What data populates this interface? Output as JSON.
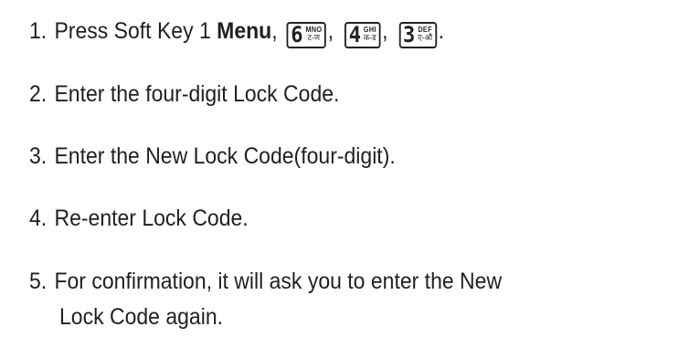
{
  "steps": [
    {
      "number": "1.",
      "text_before": "Press Soft Key 1 ",
      "bold_text": "Menu",
      "after_bold": ",",
      "keys": [
        {
          "digit": "6",
          "top": "MNO",
          "bottom": "ट-ण",
          "sep": ","
        },
        {
          "digit": "4",
          "top": "GHI",
          "bottom": "क-ड",
          "sep": ","
        },
        {
          "digit": "3",
          "top": "DEF",
          "bottom": "ए-औ",
          "sep": "."
        }
      ]
    },
    {
      "number": "2.",
      "text": "Enter the four-digit Lock Code."
    },
    {
      "number": "3.",
      "text": "Enter the New Lock Code(four-digit)."
    },
    {
      "number": "4.",
      "text": "Re-enter Lock Code."
    },
    {
      "number": "5.",
      "text": "For confirmation, it will ask you to enter the New",
      "text_line2": "Lock Code again."
    }
  ]
}
